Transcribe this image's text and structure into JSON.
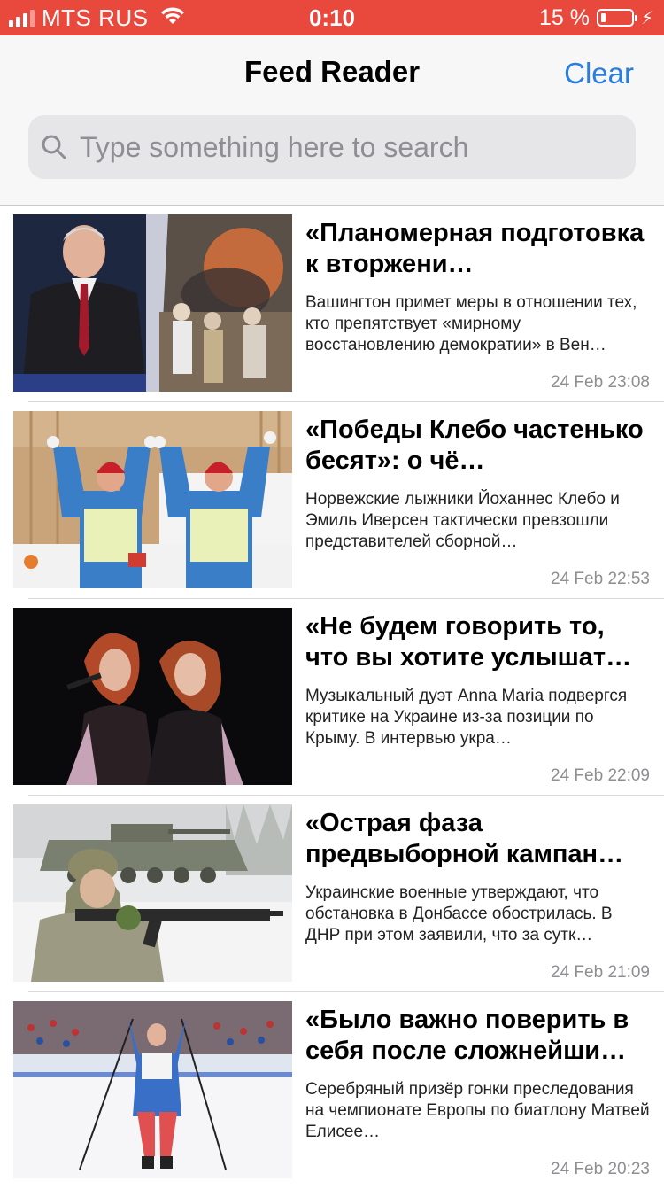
{
  "status_bar": {
    "carrier": "MTS RUS",
    "time": "0:10",
    "battery_percent": "15 %",
    "battery_level": 0.15,
    "color": "#e9493c"
  },
  "nav": {
    "title": "Feed Reader",
    "clear_label": "Clear"
  },
  "search": {
    "placeholder": "Type something here to search",
    "value": ""
  },
  "feed": {
    "items": [
      {
        "title": "«Планомерная подготовка к вторжени…",
        "description": "Вашингтон примет меры в отношении тех, кто препятствует «мирному восстановлению демократии» в Вен…",
        "date": "24 Feb 23:08",
        "image_icon": "politician-and-protest-photo"
      },
      {
        "title": "«Победы Клебо частенько бесят»: о чё…",
        "description": "Норвежские лыжники Йоханнес Клебо и Эмиль Иверсен тактически превзошли представителей сборной…",
        "date": "24 Feb 22:53",
        "image_icon": "skiers-celebrating-photo"
      },
      {
        "title": "«Не будем говорить то, что вы хотите услышат…",
        "description": "Музыкальный дуэт Anna Maria подвергся критике на Украине из-за позиции по Крыму. В интервью укра…",
        "date": "24 Feb 22:09",
        "image_icon": "singers-on-stage-photo"
      },
      {
        "title": "«Острая фаза предвыборной кампан…",
        "description": "Украинские военные утверждают, что обстановка в Донбассе обострилась. В ДНР при этом заявили, что за сутк…",
        "date": "24 Feb 21:09",
        "image_icon": "soldier-and-tank-photo"
      },
      {
        "title": "«Было важно поверить в себя после сложнейши…",
        "description": "Серебряный призёр гонки преследования на чемпионате Европы по биатлону Матвей Елисее…",
        "date": "24 Feb 20:23",
        "image_icon": "biathlete-finish-photo"
      }
    ]
  }
}
